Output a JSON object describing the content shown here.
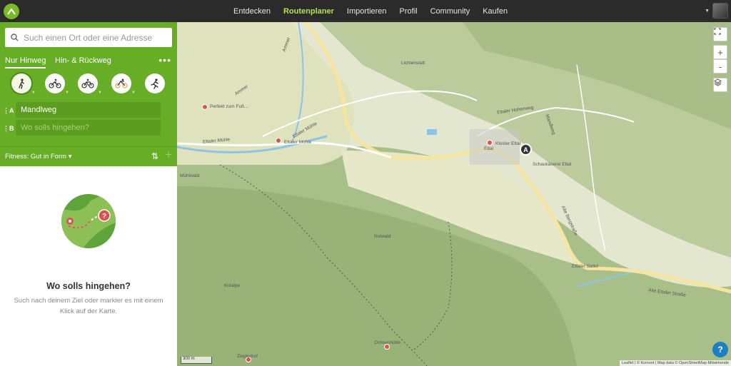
{
  "nav": {
    "items": [
      "Entdecken",
      "Routenplaner",
      "Importieren",
      "Profil",
      "Community",
      "Kaufen"
    ],
    "active_index": 1
  },
  "planner": {
    "search_placeholder": "Such einen Ort oder eine Adresse",
    "tabs": [
      "Nur Hinweg",
      "Hin- & Rückweg"
    ],
    "more_label": "•••",
    "sports": [
      "hiking-icon",
      "mountain-bike-icon",
      "touring-bike-icon",
      "road-bike-icon",
      "running-icon"
    ],
    "waypoint_a_label": "A",
    "waypoint_a_value": "Mandlweg",
    "waypoint_b_label": "B",
    "waypoint_b_placeholder": "Wo solls hingehen?",
    "fitness_label": "Fitness: Gut in Form"
  },
  "empty_state": {
    "title": "Wo solls hingehen?",
    "text": "Such nach deinem Ziel oder markier es mit einem Klick auf der Karte."
  },
  "map": {
    "labels": {
      "ammer1": "Ammer",
      "ammer2": "Ammer",
      "lichtenstaett": "Lichtenstatt",
      "perfekt": "Perfekt zum Fuß...",
      "ettaler_muehle_road": "Ettaler Mühle",
      "ettaler_muehle_road2": "Ettaler Mühle",
      "ettaler_muehle_poi": "Ettaler Mühle",
      "ettal": "Ettal",
      "kloster": "Kloster Ettal",
      "schaukaeserei": "Schaukäserei Ettal",
      "hohenweg": "Ettaler Hohenweg",
      "mandlweg": "Mandlweg",
      "muehlwald": "Mühlwald",
      "notwald": "Notwald",
      "kotalpe": "Kotalpe",
      "bergstrasse": "Alte Bergstraße",
      "ettaler_sattel": "Ettaler Sattel",
      "alte_ettaler": "Alte Ettaler Straße",
      "ochsenhuette": "Ochsenhütte",
      "zieglerhof": "Zieglerhof"
    },
    "pin_label": "A",
    "zoom_in": "+",
    "zoom_out": "-",
    "scale": "300 m",
    "attribution": "Leaflet | © Komoot | Map data © OpenStreetMap-Mitwirkende",
    "help": "?",
    "colors": {
      "road": "#f6e5a0",
      "water": "#8cc4e8",
      "forest": "#9cb57d",
      "meadow": "#dfe3bd"
    }
  }
}
